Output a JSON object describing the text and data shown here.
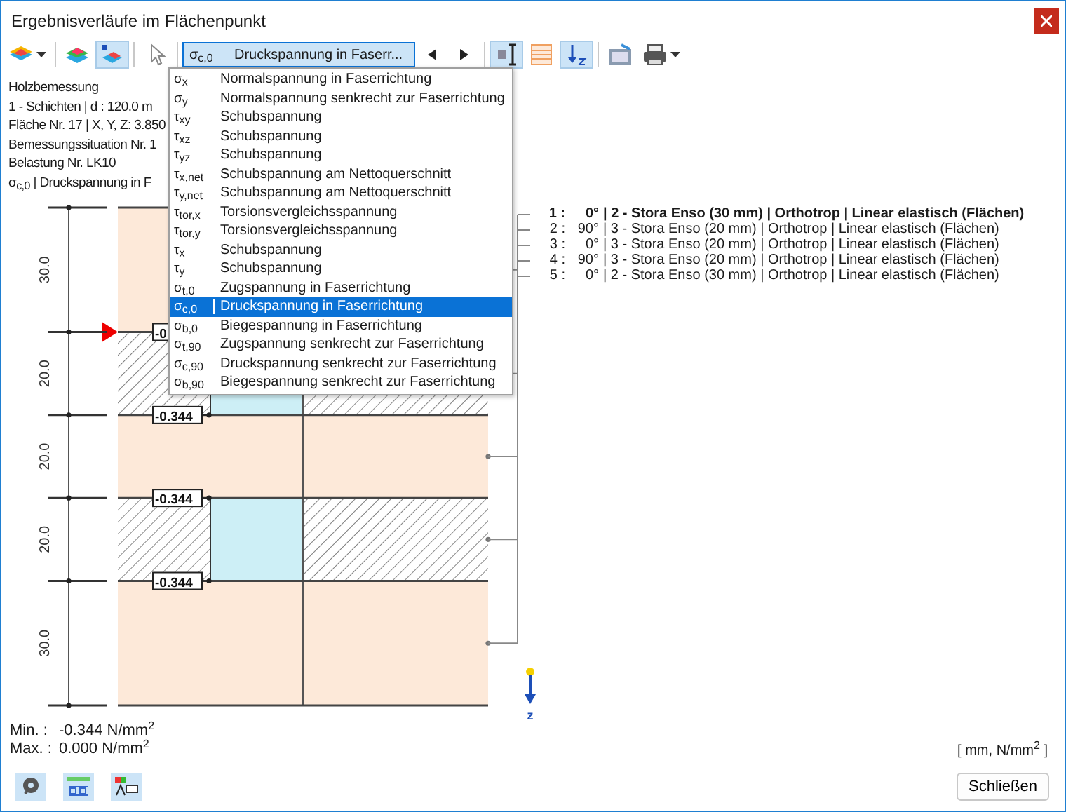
{
  "window": {
    "title": "Ergebnisverläufe im Flächenpunkt"
  },
  "toolbar": {
    "tools": [
      {
        "kind": "layers",
        "selected": false,
        "caret": true
      },
      {
        "kind": "colors",
        "selected": false
      },
      {
        "kind": "numbered",
        "selected": true
      },
      {
        "kind": "pointer",
        "selected": false
      },
      {
        "kind": "selector"
      },
      {
        "kind": "prev"
      },
      {
        "kind": "next"
      },
      {
        "kind": "dimension",
        "selected": true
      },
      {
        "kind": "grid",
        "selected": false
      },
      {
        "kind": "zaxis",
        "selected": true
      },
      {
        "kind": "table",
        "selected": false
      },
      {
        "kind": "print",
        "selected": false,
        "caret": true
      }
    ],
    "selector": {
      "symbol": "σ$_{c,0}$",
      "label": "Druckspannung in Faserr...",
      "expanded": true
    }
  },
  "stress_menu": [
    {
      "symbol": "σ$_{x}$",
      "label": "Normalspannung in Faserrichtung",
      "selected": false
    },
    {
      "symbol": "σ$_{y}$",
      "label": "Normalspannung senkrecht zur Faserrichtung",
      "selected": false
    },
    {
      "symbol": "τ$_{xy}$",
      "label": "Schubspannung",
      "selected": false
    },
    {
      "symbol": "τ$_{xz}$",
      "label": "Schubspannung",
      "selected": false
    },
    {
      "symbol": "τ$_{yz}$",
      "label": "Schubspannung",
      "selected": false
    },
    {
      "symbol": "τ$_{x,net}$",
      "label": "Schubspannung am Nettoquerschnitt",
      "selected": false
    },
    {
      "symbol": "τ$_{y,net}$",
      "label": "Schubspannung am Nettoquerschnitt",
      "selected": false
    },
    {
      "symbol": "τ$_{tor,x}$",
      "label": "Torsionsvergleichsspannung",
      "selected": false
    },
    {
      "symbol": "τ$_{tor,y}$",
      "label": "Torsionsvergleichsspannung",
      "selected": false
    },
    {
      "symbol": "τ$_{x}$",
      "label": "Schubspannung",
      "selected": false
    },
    {
      "symbol": "τ$_{y}$",
      "label": "Schubspannung",
      "selected": false
    },
    {
      "symbol": "σ$_{t,0}$",
      "label": "Zugspannung in Faserrichtung",
      "selected": false
    },
    {
      "symbol": "σ$_{c,0}$",
      "label": "Druckspannung in Faserrichtung",
      "selected": true
    },
    {
      "symbol": "σ$_{b,0}$",
      "label": "Biegespannung in Faserrichtung",
      "selected": false
    },
    {
      "symbol": "σ$_{t,90}$",
      "label": "Zugspannung senkrecht zur Faserrichtung",
      "selected": false
    },
    {
      "symbol": "σ$_{c,90}$",
      "label": "Druckspannung senkrecht zur Faserrichtung",
      "selected": false
    },
    {
      "symbol": "σ$_{b,90}$",
      "label": "Biegespannung senkrecht zur Faserrichtung",
      "selected": false
    }
  ],
  "info": [
    "Holzbemessung",
    "1 - Schichten | d : 120.0 m",
    "Fläche Nr. 17 | X, Y, Z: 3.850",
    "Bemessungssituation Nr. 1",
    "Belastung Nr. LK10",
    "σ$_{c,0}$ | Druckspannung in F"
  ],
  "cross_section": {
    "layers": [
      {
        "thickness": "30.0",
        "kind": "plain",
        "selected": false
      },
      {
        "thickness": "20.0",
        "kind": "hatched",
        "selected": true,
        "top_label": "-0",
        "bottom_label": "-0.344"
      },
      {
        "thickness": "20.0",
        "kind": "plain",
        "selected": false
      },
      {
        "thickness": "20.0",
        "kind": "hatched",
        "selected": false,
        "top_label": "-0.344",
        "bottom_label": "-0.344"
      },
      {
        "thickness": "30.0",
        "kind": "plain",
        "selected": false
      }
    ],
    "axis_label": "z"
  },
  "legend": [
    {
      "number": "1 :",
      "angle": "0°",
      "text": "| 2 - Stora Enso (30 mm) | Orthotrop | Linear elastisch (Flächen)",
      "selected": true
    },
    {
      "number": "2 :",
      "angle": "90°",
      "text": "| 3 - Stora Enso (20 mm) | Orthotrop | Linear elastisch (Flächen)",
      "selected": false
    },
    {
      "number": "3 :",
      "angle": "0°",
      "text": "| 3 - Stora Enso (20 mm) | Orthotrop | Linear elastisch (Flächen)",
      "selected": false
    },
    {
      "number": "4 :",
      "angle": "90°",
      "text": "| 3 - Stora Enso (20 mm) | Orthotrop | Linear elastisch (Flächen)",
      "selected": false
    },
    {
      "number": "5 :",
      "angle": "0°",
      "text": "| 2 - Stora Enso (30 mm) | Orthotrop | Linear elastisch (Flächen)",
      "selected": false
    }
  ],
  "summary": [
    {
      "label": "Min. :",
      "value": "-0.344 N/mm$^{2}$"
    },
    {
      "label": "Max. :",
      "value": "0.000 N/mm$^{2}$"
    }
  ],
  "units": "[ mm, N/mm$^{2}$ ]",
  "footer_tools": [
    {
      "kind": "help"
    },
    {
      "kind": "decimals"
    },
    {
      "kind": "labels"
    }
  ],
  "close_button": "Schließen"
}
